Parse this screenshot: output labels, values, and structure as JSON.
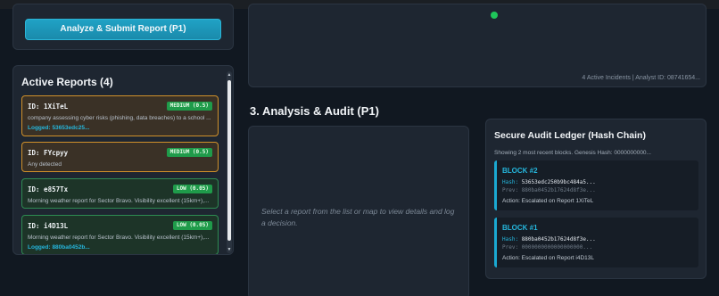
{
  "submit": {
    "label": "Analyze & Submit Report (P1)"
  },
  "map": {
    "status": "4 Active Incidents | Analyst ID: 08741654..."
  },
  "reports": {
    "title": "Active Reports (4)",
    "items": [
      {
        "id": "ID: 1XiTeL",
        "severity": "MEDIUM (0.5)",
        "level": "medium",
        "desc": "company assessing cyber risks (phishing, data breaches) to a school ...",
        "logged": "Logged: 53653edc25..."
      },
      {
        "id": "ID: FYcpyy",
        "severity": "MEDIUM (0.5)",
        "level": "medium",
        "desc": "Any detected",
        "logged": ""
      },
      {
        "id": "ID: e857Tx",
        "severity": "LOW (0.05)",
        "level": "low",
        "desc": "Morning weather report for Sector Bravo. Visibility excellent (15km+),...",
        "logged": ""
      },
      {
        "id": "ID: i4D13L",
        "severity": "LOW (0.05)",
        "level": "low",
        "desc": "Morning weather report for Sector Bravo. Visibility excellent (15km+),...",
        "logged": "Logged: 880ba0452b..."
      }
    ]
  },
  "analysis": {
    "title": "3. Analysis & Audit (P1)",
    "placeholder": "Select a report from the list or map to view details and log a decision."
  },
  "ledger": {
    "title": "Secure Audit Ledger (Hash Chain)",
    "info": "Showing 2 most recent blocks. Genesis Hash: 0000000000...",
    "blocks": [
      {
        "title": "BLOCK #2",
        "hash_label": "Hash:",
        "hash": "53653edc250b9bc484a5...",
        "prev_label": "Prev:",
        "prev": "880ba0452b17624d8f3e...",
        "action": "Action: Escalated on Report 1XiTeL"
      },
      {
        "title": "BLOCK #1",
        "hash_label": "Hash:",
        "hash": "880ba0452b17624d8f3e...",
        "prev_label": "Prev:",
        "prev": "0000000000000000000...",
        "action": "Action: Escalated on Report i4D13L"
      }
    ]
  },
  "colors": {
    "accent": "#25b6dc",
    "medium_border": "#d1912a",
    "low_border": "#2e8c52",
    "badge": "#1f9b4a",
    "live_dot": "#1fc65a"
  }
}
